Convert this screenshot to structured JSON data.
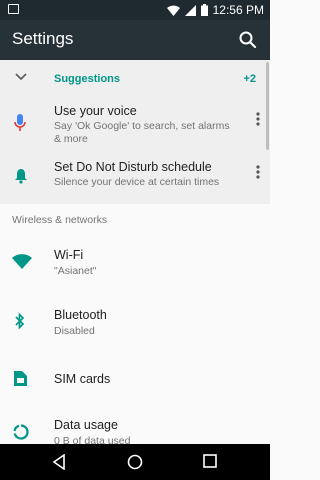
{
  "status": {
    "time": "12:56 PM"
  },
  "toolbar": {
    "title": "Settings"
  },
  "suggestions": {
    "label": "Suggestions",
    "count": "+2",
    "items": [
      {
        "title": "Use your voice",
        "subtitle": "Say 'Ok Google' to search, set alarms & more"
      },
      {
        "title": "Set Do Not Disturb schedule",
        "subtitle": "Silence your device at certain times"
      }
    ]
  },
  "sections": [
    {
      "header": "Wireless & networks",
      "items": [
        {
          "title": "Wi-Fi",
          "subtitle": "\"Asianet\""
        },
        {
          "title": "Bluetooth",
          "subtitle": "Disabled"
        },
        {
          "title": "SIM cards",
          "subtitle": ""
        },
        {
          "title": "Data usage",
          "subtitle": "0 B of data used"
        }
      ]
    }
  ],
  "colors": {
    "accent": "#009688",
    "toolbar": "#263238",
    "statusbar": "#1f2a30"
  }
}
